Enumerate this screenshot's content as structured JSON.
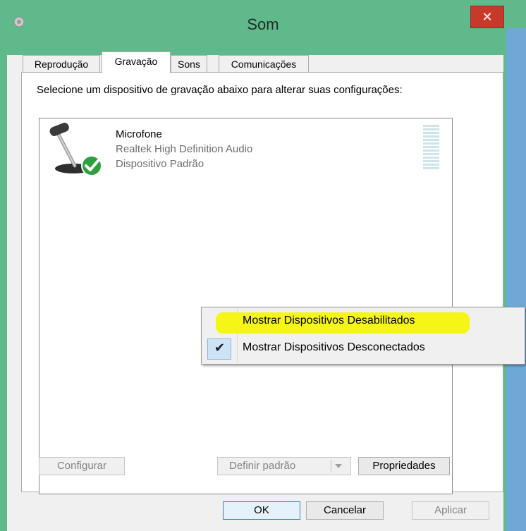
{
  "window": {
    "title": "Som",
    "close_glyph": "✕"
  },
  "tabs": [
    {
      "label": "Reprodução",
      "active": false
    },
    {
      "label": "Gravação",
      "active": true
    },
    {
      "label": "Sons",
      "active": false
    },
    {
      "label": "Comunicações",
      "active": false
    }
  ],
  "main": {
    "instructions": "Selecione um dispositivo de gravação abaixo para alterar suas configurações:",
    "device": {
      "name": "Microfone",
      "driver": "Realtek High Definition Audio",
      "status": "Dispositivo Padrão",
      "icon": "microphone-icon",
      "status_icon": "default-check-icon"
    }
  },
  "buttons": {
    "configure": "Configurar",
    "set_default": "Definir padrão",
    "properties": "Propriedades",
    "ok": "OK",
    "cancel": "Cancelar",
    "apply": "Aplicar"
  },
  "context_menu": {
    "items": [
      {
        "label": "Mostrar Dispositivos Desabilitados",
        "checked": false,
        "highlighted": true
      },
      {
        "label": "Mostrar Dispositivos Desconectados",
        "checked": true,
        "highlighted": false
      }
    ],
    "check_glyph": "✔"
  },
  "colors": {
    "title_bar": "#5fb98a",
    "close_button": "#c7392b",
    "highlight": "#f5f516",
    "check_bg": "#cde4f7"
  }
}
